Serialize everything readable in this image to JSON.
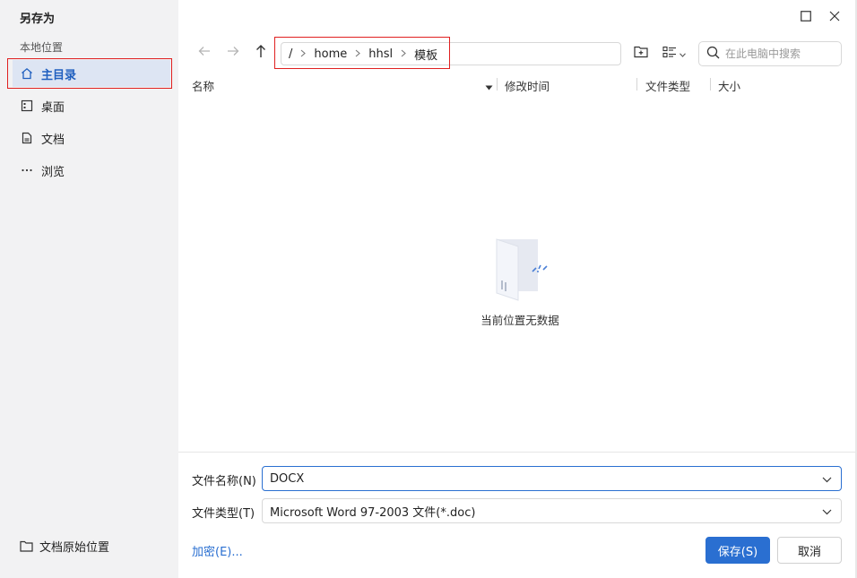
{
  "dialog": {
    "title": "另存为"
  },
  "sidebar": {
    "section_label": "本地位置",
    "items": [
      {
        "label": "主目录",
        "icon": "home-icon",
        "active": true
      },
      {
        "label": "桌面",
        "icon": "desktop-icon",
        "active": false
      },
      {
        "label": "文档",
        "icon": "document-icon",
        "active": false
      },
      {
        "label": "浏览",
        "icon": "more-dots-icon",
        "active": false
      }
    ],
    "bottom_item": {
      "label": "文档原始位置",
      "icon": "folder-icon"
    }
  },
  "toolbar": {
    "breadcrumb": [
      "/",
      "home",
      "hhsl",
      "模板"
    ],
    "search_placeholder": "在此电脑中搜索"
  },
  "columns": {
    "name": "名称",
    "modified": "修改时间",
    "type": "文件类型",
    "size": "大小"
  },
  "empty_state": {
    "text": "当前位置无数据"
  },
  "form": {
    "filename_label": "文件名称(N)",
    "filename_value": "DOCX",
    "filetype_label": "文件类型(T)",
    "filetype_value": "Microsoft Word 97-2003 文件(*.doc)",
    "encrypt_link": "加密(E)...",
    "save_label": "保存(S)",
    "cancel_label": "取消"
  },
  "colors": {
    "accent": "#2a6fd1",
    "highlight_box": "#e02020",
    "sidebar_bg": "#f2f2f3",
    "active_item_bg": "#dde5f3"
  }
}
